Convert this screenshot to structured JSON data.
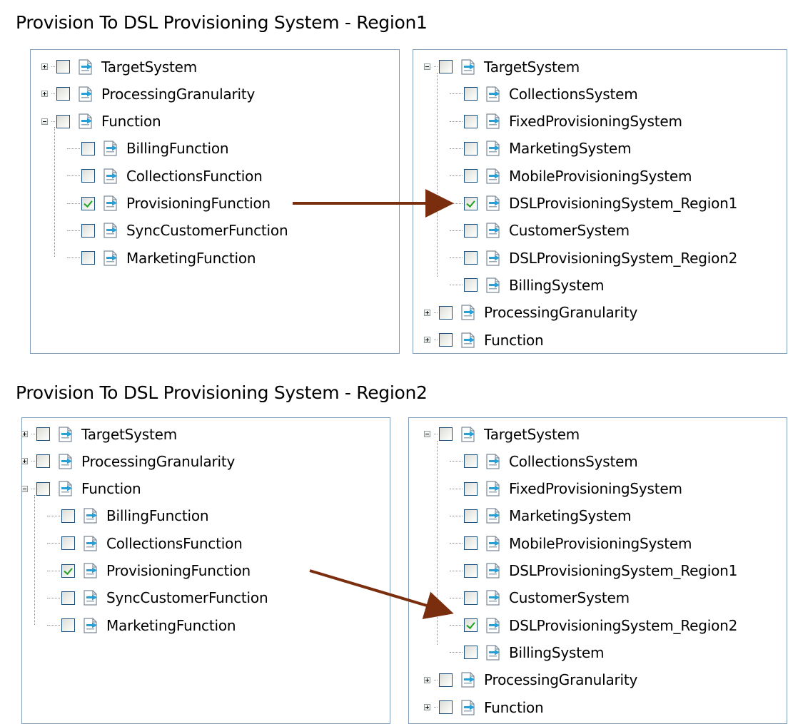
{
  "section1": {
    "title": "Provision To DSL Provisioning System - Region1",
    "left_tree": [
      {
        "label": "TargetSystem",
        "expander": "plus",
        "checked": false
      },
      {
        "label": "ProcessingGranularity",
        "expander": "plus",
        "checked": false
      },
      {
        "label": "Function",
        "expander": "minus",
        "checked": false
      },
      {
        "label": "BillingFunction",
        "checked": false
      },
      {
        "label": "CollectionsFunction",
        "checked": false
      },
      {
        "label": "ProvisioningFunction",
        "checked": true
      },
      {
        "label": "SyncCustomerFunction",
        "checked": false
      },
      {
        "label": "MarketingFunction",
        "checked": false
      }
    ],
    "right_tree": [
      {
        "label": "TargetSystem",
        "expander": "minus",
        "checked": false
      },
      {
        "label": "CollectionsSystem",
        "checked": false
      },
      {
        "label": "FixedProvisioningSystem",
        "checked": false
      },
      {
        "label": "MarketingSystem",
        "checked": false
      },
      {
        "label": "MobileProvisioningSystem",
        "checked": false
      },
      {
        "label": "DSLProvisioningSystem_Region1",
        "checked": true
      },
      {
        "label": "CustomerSystem",
        "checked": false
      },
      {
        "label": "DSLProvisioningSystem_Region2",
        "checked": false
      },
      {
        "label": "BillingSystem",
        "checked": false
      },
      {
        "label": "ProcessingGranularity",
        "expander": "plus",
        "checked": false
      },
      {
        "label": "Function",
        "expander": "plus",
        "checked": false
      }
    ]
  },
  "section2": {
    "title": "Provision To DSL Provisioning System - Region2",
    "left_tree": [
      {
        "label": "TargetSystem",
        "expander": "plus",
        "checked": false
      },
      {
        "label": "ProcessingGranularity",
        "expander": "plus",
        "checked": false
      },
      {
        "label": "Function",
        "expander": "minus",
        "checked": false
      },
      {
        "label": "BillingFunction",
        "checked": false
      },
      {
        "label": "CollectionsFunction",
        "checked": false
      },
      {
        "label": "ProvisioningFunction",
        "checked": true
      },
      {
        "label": "SyncCustomerFunction",
        "checked": false
      },
      {
        "label": "MarketingFunction",
        "checked": false
      }
    ],
    "right_tree": [
      {
        "label": "TargetSystem",
        "expander": "minus",
        "checked": false
      },
      {
        "label": "CollectionsSystem",
        "checked": false
      },
      {
        "label": "FixedProvisioningSystem",
        "checked": false
      },
      {
        "label": "MarketingSystem",
        "checked": false
      },
      {
        "label": "MobileProvisioningSystem",
        "checked": false
      },
      {
        "label": "DSLProvisioningSystem_Region1",
        "checked": false
      },
      {
        "label": "CustomerSystem",
        "checked": false
      },
      {
        "label": "DSLProvisioningSystem_Region2",
        "checked": true
      },
      {
        "label": "BillingSystem",
        "checked": false
      },
      {
        "label": "ProcessingGranularity",
        "expander": "plus",
        "checked": false
      },
      {
        "label": "Function",
        "expander": "plus",
        "checked": false
      }
    ]
  },
  "colors": {
    "arrow": "#7a2e0e",
    "panel_border": "#7f9db9",
    "check": "#21a121",
    "checkbox_border": "#1c5180",
    "icon_accent": "#2a9fd6"
  },
  "icons": {
    "tree_node": "document-arrow-icon",
    "expand": "plus-expander-icon",
    "collapse": "minus-expander-icon"
  }
}
